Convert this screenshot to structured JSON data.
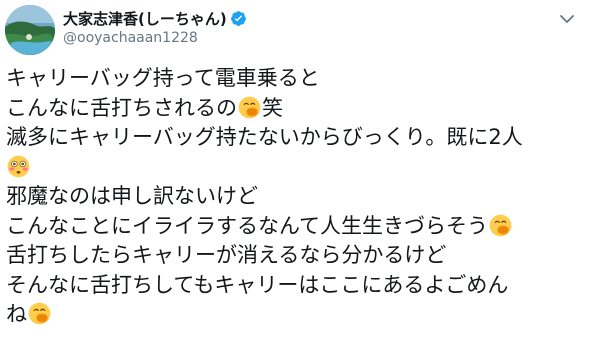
{
  "user": {
    "display_name": "大家志津香(しーちゃん)",
    "handle": "@ooyachaaan1228",
    "verified_icon": "verified-badge-icon",
    "avatar_icon": "profile-avatar"
  },
  "menu": {
    "icon": "chevron-down-icon"
  },
  "tweet": {
    "lines": [
      {
        "text_a": "キャリーバッグ持って電車乗ると",
        "emoji": "",
        "text_b": ""
      },
      {
        "text_a": "こんなに舌打ちされるの",
        "emoji": "face-with-hand-over-mouth",
        "text_b": "笑"
      },
      {
        "text_a": "滅多にキャリーバッグ持たないからびっくり。既に2人",
        "emoji": "",
        "text_b": ""
      },
      {
        "text_a": "",
        "emoji": "flushed-face",
        "text_b": ""
      },
      {
        "text_a": "邪魔なのは申し訳ないけど",
        "emoji": "",
        "text_b": ""
      },
      {
        "text_a": "こんなことにイライラするなんて人生生きづらそう",
        "emoji": "face-with-hand-over-mouth",
        "text_b": ""
      },
      {
        "text_a": "舌打ちしたらキャリーが消えるなら分かるけど",
        "emoji": "",
        "text_b": ""
      },
      {
        "text_a": "そんなに舌打ちしてもキャリーはここにあるよごめん",
        "emoji": "",
        "text_b": ""
      },
      {
        "text_a": "ね",
        "emoji": "face-with-hand-over-mouth",
        "text_b": ""
      }
    ]
  },
  "colors": {
    "text_primary": "#14171a",
    "text_secondary": "#657786",
    "verified_blue": "#1da1f2",
    "emoji_yellow": "#ffcc4d"
  }
}
